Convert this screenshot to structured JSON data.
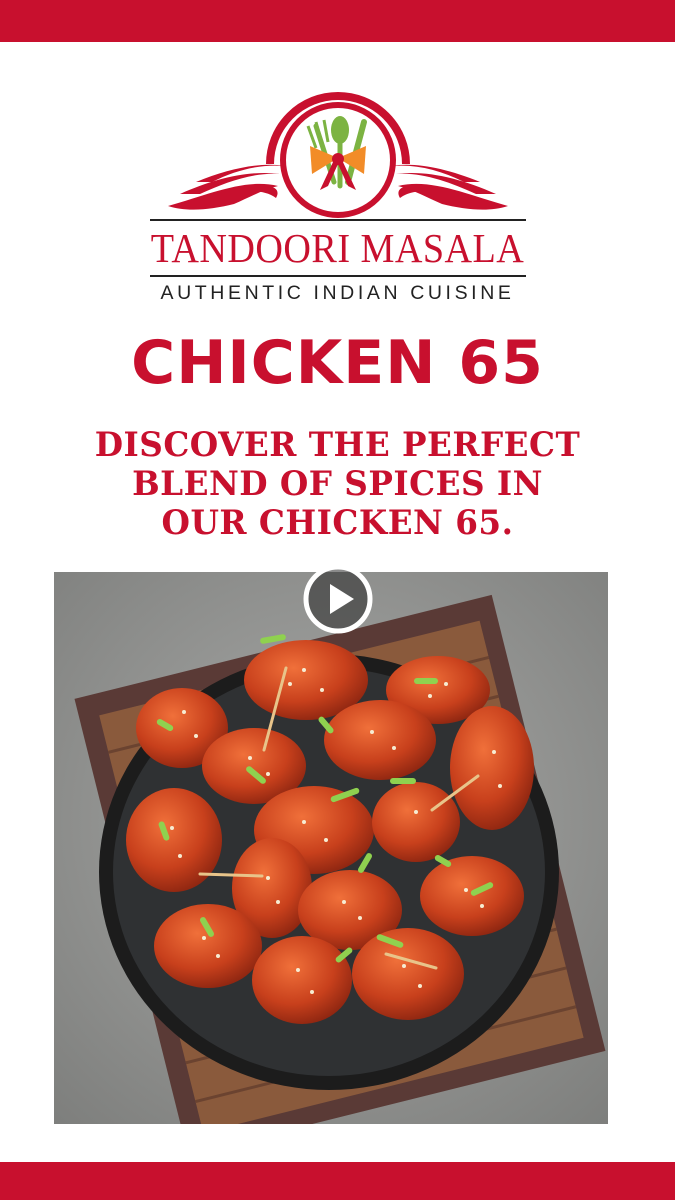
{
  "brand": {
    "name": "TANDOORI MASALA",
    "tagline": "AUTHENTIC INDIAN CUISINE",
    "colors": {
      "primary": "#c8102e",
      "accent_green": "#7cb342",
      "accent_orange": "#f28c28"
    }
  },
  "post": {
    "dish_title": "CHICKEN 65",
    "headline_lines": [
      "DISCOVER THE PERFECT",
      "BLEND OF SPICES IN",
      "OUR CHICKEN 65."
    ]
  },
  "media": {
    "type": "video",
    "subject": "plate of Chicken 65",
    "play_icon": "play-icon"
  }
}
